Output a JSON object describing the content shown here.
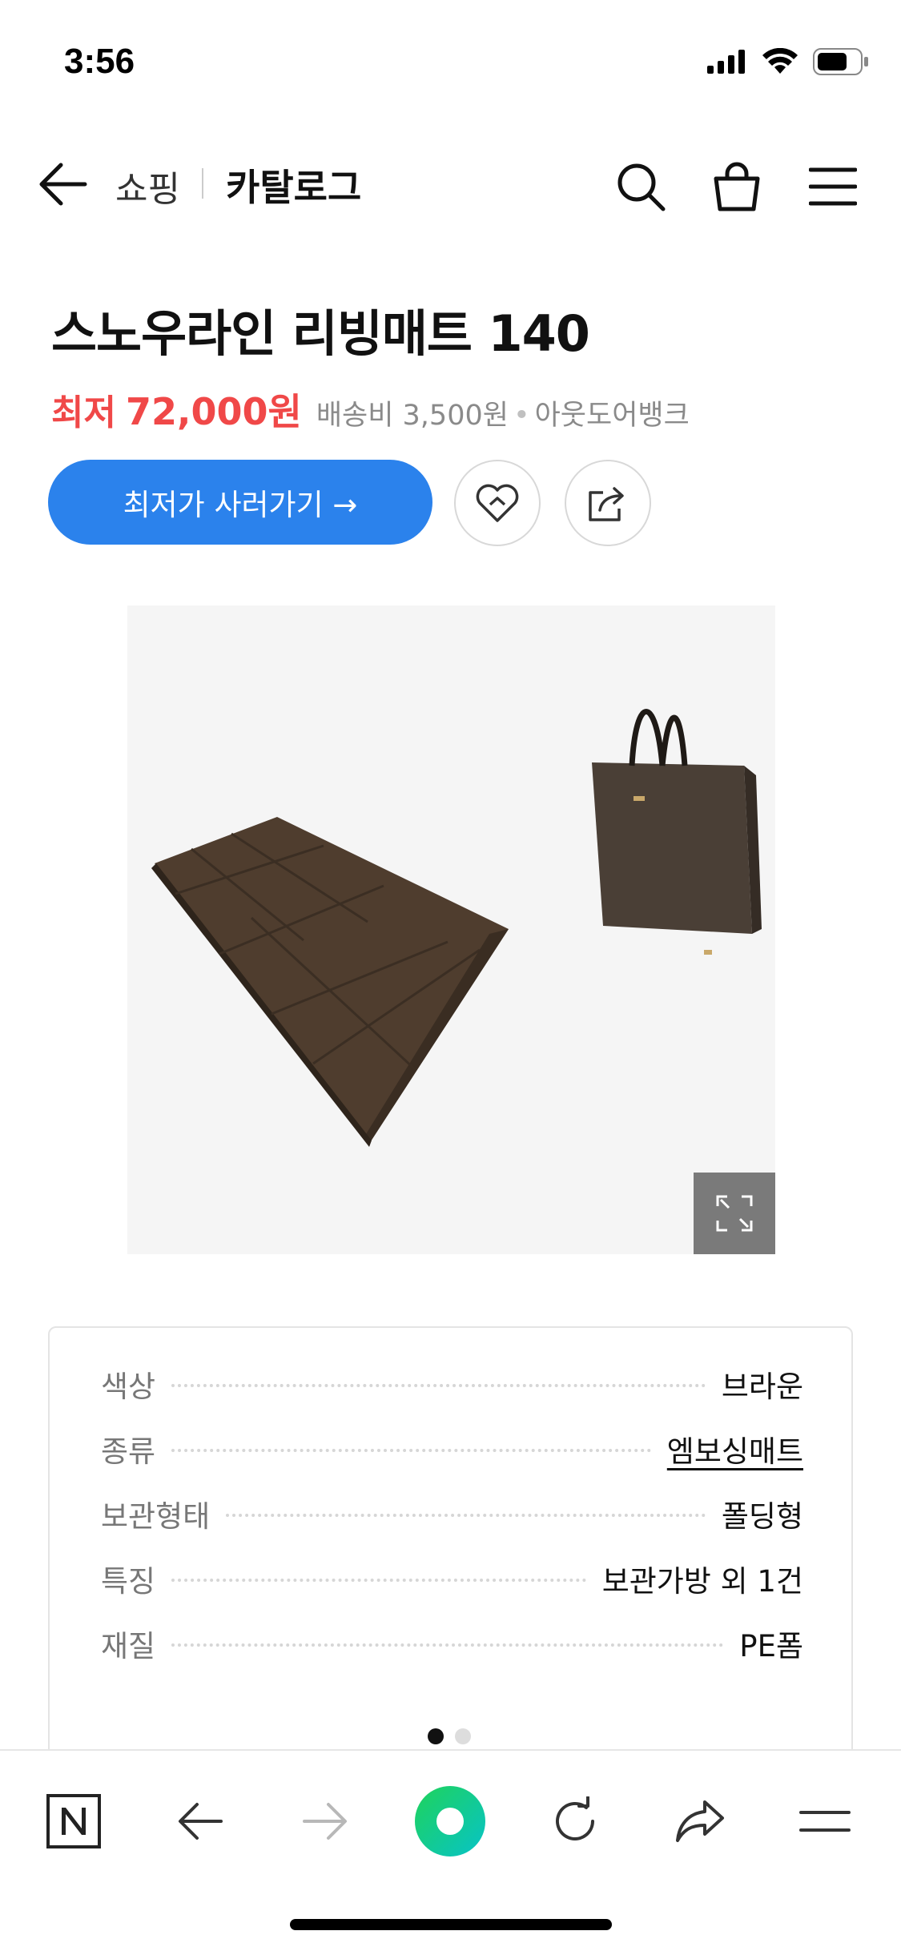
{
  "status_bar": {
    "time": "3:56"
  },
  "header": {
    "breadcrumb_shop": "쇼핑",
    "breadcrumb_catalog": "카탈로그"
  },
  "product": {
    "title": "스노우라인 리빙매트 140",
    "price_label": "최저",
    "price": "72,000원",
    "shipping": "배송비 3,500원",
    "seller": "아웃도어뱅크",
    "buy_button": "최저가 사러가기 →"
  },
  "specs": [
    {
      "label": "색상",
      "value": "브라운"
    },
    {
      "label": "종류",
      "value": "엠보싱매트"
    },
    {
      "label": "보관형태",
      "value": "폴딩형"
    },
    {
      "label": "특징",
      "value": "보관가방 외 1건"
    },
    {
      "label": "재질",
      "value": "PE폼"
    }
  ],
  "spec_pager": {
    "total": 2,
    "active": 1
  },
  "colors": {
    "accent_blue": "#2b82ec",
    "price_red": "#f04848",
    "toolbar_green": "#03c75a"
  },
  "icons": {
    "header": [
      "back-arrow-icon",
      "search-icon",
      "shopping-bag-icon",
      "menu-icon"
    ],
    "actions": [
      "heart-icon",
      "share-icon"
    ],
    "toolbar": [
      "naver-n-icon",
      "back-icon",
      "forward-icon",
      "green-dot-home-icon",
      "reload-icon",
      "share-icon",
      "menu-icon"
    ]
  }
}
